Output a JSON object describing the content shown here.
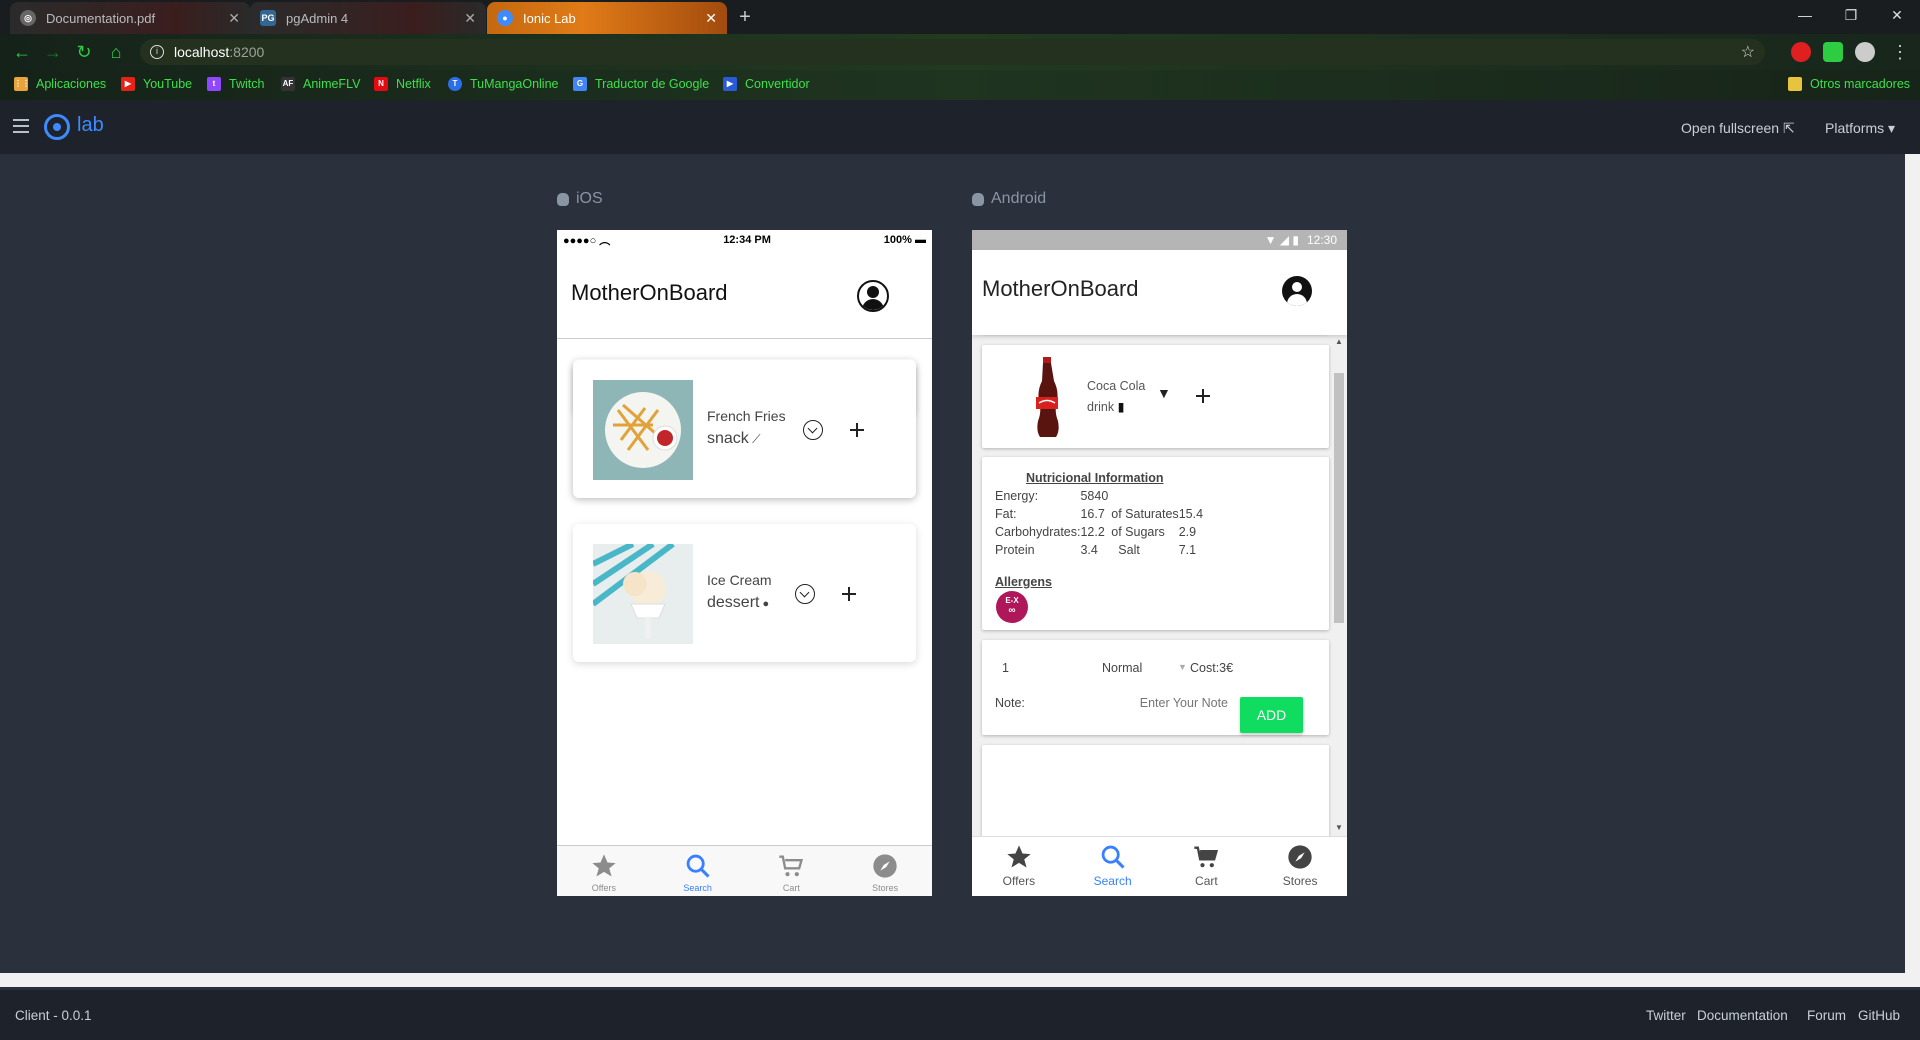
{
  "browser": {
    "tabs": [
      {
        "title": "Documentation.pdf",
        "icon": "globe-icon"
      },
      {
        "title": "pgAdmin 4",
        "icon": "pgadmin-icon"
      },
      {
        "title": "Ionic Lab",
        "icon": "ionic-icon"
      }
    ],
    "url_host": "localhost",
    "url_port": ":8200",
    "bookmarks": [
      {
        "label": "Aplicaciones",
        "color": "#e8a33d"
      },
      {
        "label": "YouTube",
        "color": "#e62117"
      },
      {
        "label": "Twitch",
        "color": "#9146ff"
      },
      {
        "label": "AnimeFLV",
        "color": "#333333"
      },
      {
        "label": "Netflix",
        "color": "#e50914"
      },
      {
        "label": "TuMangaOnline",
        "color": "#2a6ee8"
      },
      {
        "label": "Traductor de Google",
        "color": "#4285f4"
      },
      {
        "label": "Convertidor",
        "color": "#2a5bd7"
      }
    ],
    "other_bookmarks": "Otros marcadores"
  },
  "lab": {
    "logo_text": "lab",
    "open_fullscreen": "Open fullscreen",
    "platforms": "Platforms",
    "ios_label": "iOS",
    "android_label": "Android",
    "accent": "#3d8bff"
  },
  "ios": {
    "time": "12:34 PM",
    "battery": "100%",
    "title": "MotherOnBoard",
    "items": [
      {
        "name": "French Fries",
        "category": "snack"
      },
      {
        "name": "Ice Cream",
        "category": "dessert"
      }
    ],
    "tabs": [
      "Offers",
      "Search",
      "Cart",
      "Stores"
    ],
    "selected_tab": "Search"
  },
  "android": {
    "time": "12:30",
    "title": "MotherOnBoard",
    "product": {
      "name": "Coca Cola",
      "category": "drink"
    },
    "nutrition": {
      "heading": "Nutricional Information",
      "rows": [
        {
          "label": "Energy:",
          "value": "5840",
          "label2": "",
          "value2": ""
        },
        {
          "label": "Fat:",
          "value": "16.7",
          "label2": "of Saturates",
          "value2": "15.4"
        },
        {
          "label": "Carbohydrates:",
          "value": "12.2",
          "label2": "of Sugars",
          "value2": "2.9"
        },
        {
          "label": "Protein",
          "value": "3.4",
          "label2": "Salt",
          "value2": "7.1"
        }
      ],
      "allergens_heading": "Allergens",
      "allergen_badge": "E-X"
    },
    "order": {
      "quantity": "1",
      "size": "Normal",
      "cost": "Cost:3€",
      "note_label": "Note:",
      "note_placeholder": "Enter Your Note",
      "add_label": "ADD"
    },
    "tabs": [
      "Offers",
      "Search",
      "Cart",
      "Stores"
    ],
    "selected_tab": "Search"
  },
  "footer": {
    "version": "Client - 0.0.1",
    "links": [
      "Twitter",
      "Documentation",
      "Forum",
      "GitHub"
    ]
  }
}
